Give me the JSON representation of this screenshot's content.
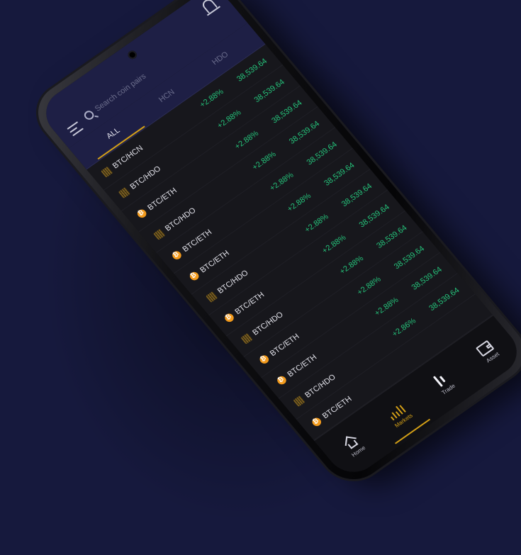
{
  "search": {
    "placeholder": "Search coin pairs"
  },
  "tabs": [
    {
      "label": "ALL"
    },
    {
      "label": "HCN"
    },
    {
      "label": "HDO"
    }
  ],
  "rows": [
    {
      "pair": "BTC/HCN",
      "change": "+2.88%",
      "price": "38,539.64",
      "icon": "grid"
    },
    {
      "pair": "BTC/HDO",
      "change": "+2.88%",
      "price": "38,539.64",
      "icon": "grid"
    },
    {
      "pair": "BTC/ETH",
      "change": "+2.88%",
      "price": "38,539.64",
      "icon": "btc"
    },
    {
      "pair": "BTC/HDO",
      "change": "+2.88%",
      "price": "38,539.64",
      "icon": "grid"
    },
    {
      "pair": "BTC/ETH",
      "change": "+2.88%",
      "price": "38,539.64",
      "icon": "btc"
    },
    {
      "pair": "BTC/ETH",
      "change": "+2.88%",
      "price": "38,539.64",
      "icon": "btc"
    },
    {
      "pair": "BTC/HDO",
      "change": "+2.88%",
      "price": "38,539.64",
      "icon": "grid"
    },
    {
      "pair": "BTC/ETH",
      "change": "+2.88%",
      "price": "38,539.64",
      "icon": "btc"
    },
    {
      "pair": "BTC/HDO",
      "change": "+2.88%",
      "price": "38,539.64",
      "icon": "grid"
    },
    {
      "pair": "BTC/ETH",
      "change": "+2.88%",
      "price": "38,539.64",
      "icon": "btc"
    },
    {
      "pair": "BTC/ETH",
      "change": "+2.88%",
      "price": "38,539.64",
      "icon": "btc"
    },
    {
      "pair": "BTC/HDO",
      "change": "+2.86%",
      "price": "38,539.64",
      "icon": "grid"
    },
    {
      "pair": "BTC/ETH",
      "change": "",
      "price": "",
      "icon": "btc"
    }
  ],
  "bottom_nav": [
    {
      "label": "Home",
      "icon": "home-icon"
    },
    {
      "label": "Markets",
      "icon": "markets-icon"
    },
    {
      "label": "Trade",
      "icon": "trade-icon"
    },
    {
      "label": "Asset",
      "icon": "wallet-icon"
    }
  ],
  "colors": {
    "background": "#16193d",
    "header": "#1e1f45",
    "accent": "#d4a017",
    "positive": "#25c27a"
  }
}
